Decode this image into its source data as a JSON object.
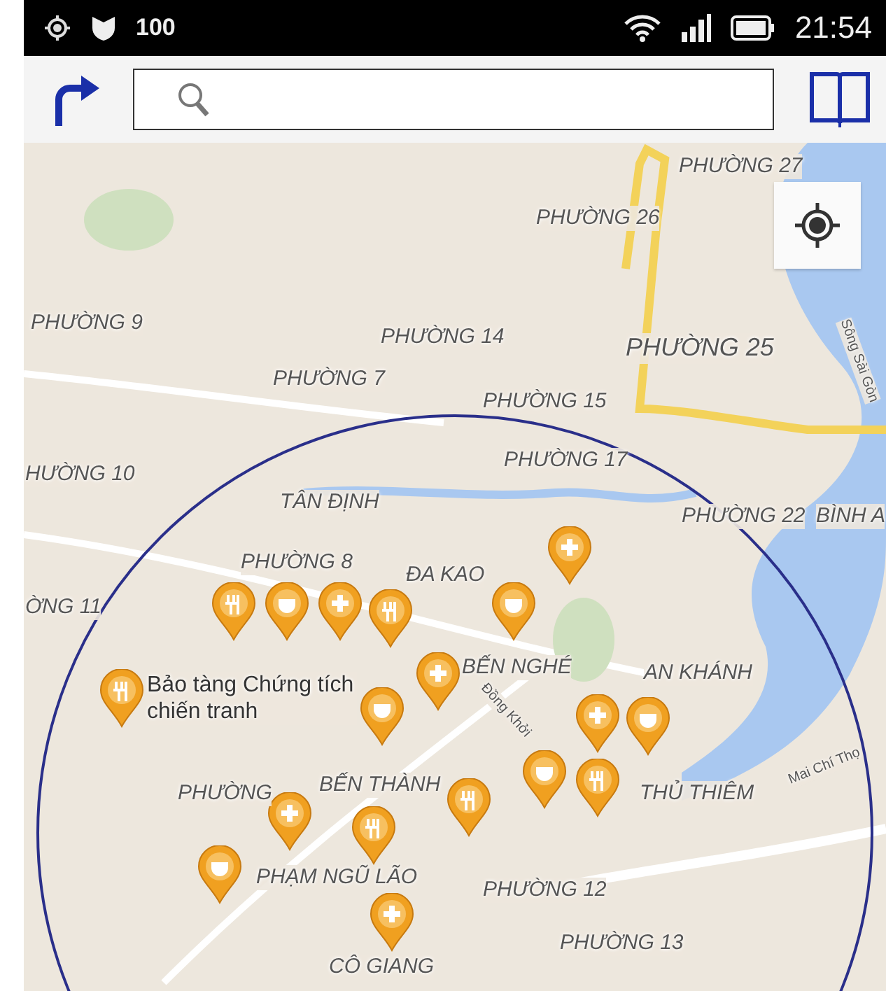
{
  "status_bar": {
    "count": "100",
    "time": "21:54"
  },
  "map": {
    "labels": [
      {
        "kind": "area",
        "text": "PHƯỜNG 27"
      },
      {
        "kind": "area",
        "text": "PHƯỜNG 26"
      },
      {
        "kind": "area",
        "text": "PHƯỜNG 9"
      },
      {
        "kind": "area",
        "text": "PHƯỜNG 14"
      },
      {
        "kind": "area",
        "text": "PHƯỜNG 25"
      },
      {
        "kind": "area",
        "text": "PHƯỜNG 7"
      },
      {
        "kind": "area",
        "text": "PHƯỜNG 15"
      },
      {
        "kind": "area",
        "text": "HƯỜNG 10"
      },
      {
        "kind": "area",
        "text": "PHƯỜNG 17"
      },
      {
        "kind": "area",
        "text": "TÂN ĐỊNH"
      },
      {
        "kind": "area",
        "text": "PHƯỜNG 22"
      },
      {
        "kind": "area",
        "text": "BÌNH A"
      },
      {
        "kind": "area",
        "text": "PHƯỜNG 8"
      },
      {
        "kind": "area",
        "text": "ĐA KAO"
      },
      {
        "kind": "area",
        "text": "ỜNG 11"
      },
      {
        "kind": "area",
        "text": "BẾN NGHÉ"
      },
      {
        "kind": "area",
        "text": "AN KHÁNH"
      },
      {
        "kind": "poi",
        "text": "Bảo tàng Chứng tích chiến tranh"
      },
      {
        "kind": "street",
        "text": "Đồng Khởi"
      },
      {
        "kind": "street",
        "text": "Mai Chí Thọ"
      },
      {
        "kind": "area",
        "text": "PHƯỜNG"
      },
      {
        "kind": "area",
        "text": "BẾN THÀNH"
      },
      {
        "kind": "area",
        "text": "THỦ THIÊM"
      },
      {
        "kind": "area",
        "text": "PHẠM NGŨ LÃO"
      },
      {
        "kind": "area",
        "text": "PHƯỜNG 12"
      },
      {
        "kind": "area",
        "text": "PHƯỜNG 13"
      },
      {
        "kind": "area",
        "text": "CÔ GIANG"
      },
      {
        "kind": "street",
        "text": "Sông Sài Gòn"
      }
    ]
  }
}
